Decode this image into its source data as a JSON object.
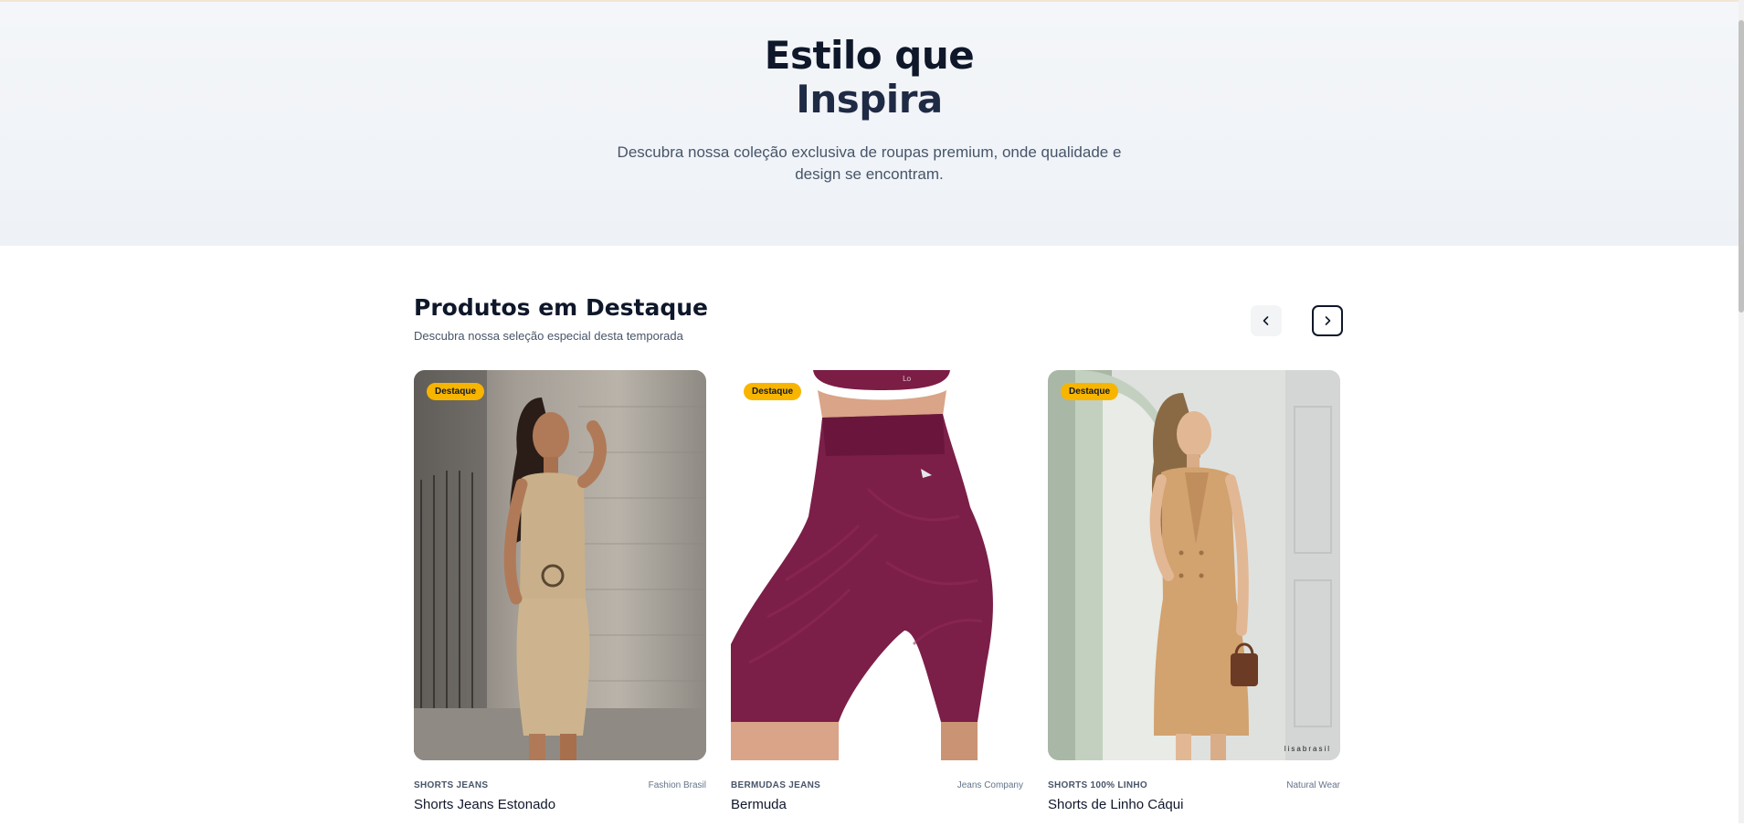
{
  "hero": {
    "title_line1": "Estilo que",
    "title_line2": "Inspira",
    "description": "Descubra nossa coleção exclusiva de roupas premium, onde qualidade e design se encontram."
  },
  "featured": {
    "title": "Produtos em Destaque",
    "subtitle": "Descubra nossa seleção especial desta temporada",
    "prev_icon": "chevron-left-icon",
    "next_icon": "chevron-right-icon"
  },
  "products": [
    {
      "badge": "Destaque",
      "category": "SHORTS JEANS",
      "brand": "Fashion Brasil",
      "name": "Shorts Jeans Estonado",
      "image": "woman in beige ruched mini dress"
    },
    {
      "badge": "Destaque",
      "category": "BERMUDAS JEANS",
      "brand": "Jeans Company",
      "name": "Bermuda",
      "image": "burgundy textured biker shorts"
    },
    {
      "badge": "Destaque",
      "category": "SHORTS 100% LINHO",
      "brand": "Natural Wear",
      "name": "Shorts de Linho Cáqui",
      "image": "woman in tan blazer dress",
      "watermark": "lisabrasil"
    }
  ],
  "colors": {
    "accent_badge": "#f7b500",
    "heading": "#0f172a",
    "hero_bg": "#f1f4f8"
  }
}
